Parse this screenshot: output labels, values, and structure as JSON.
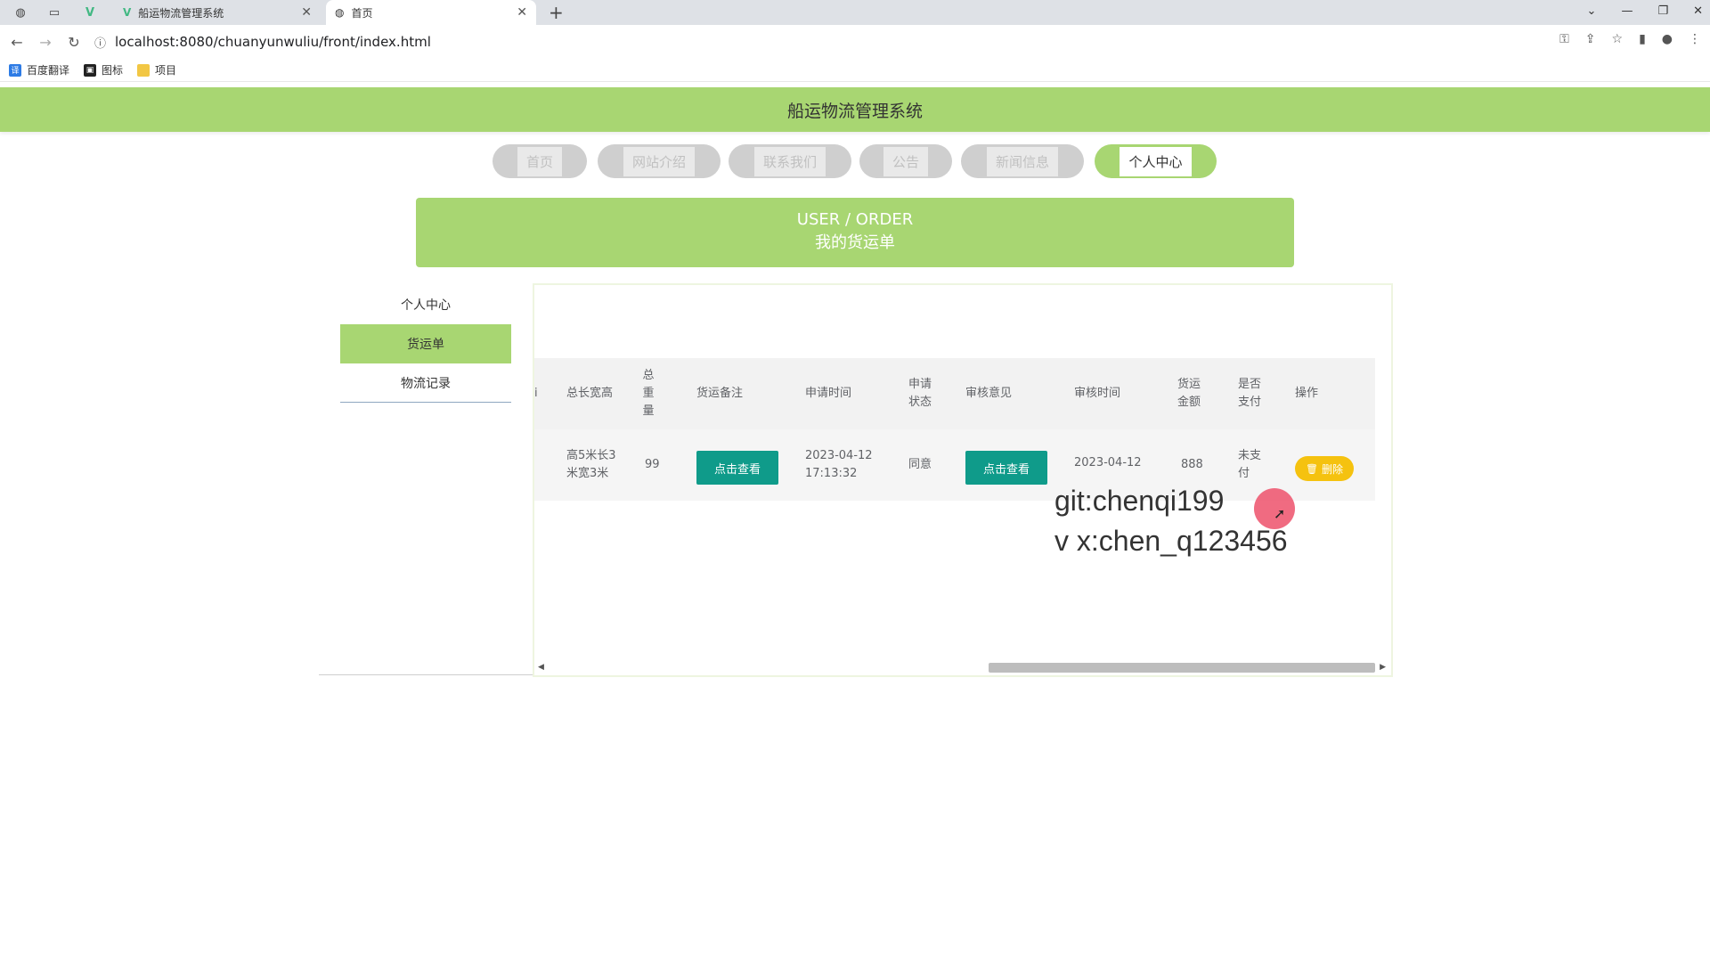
{
  "browser": {
    "tabs": [
      {
        "title": "船运物流管理系统",
        "icon": "vue-logo-icon"
      },
      {
        "title": "首页",
        "icon": "globe-icon"
      }
    ],
    "url": "localhost:8080/chuanyunwuliu/front/index.html",
    "bookmarks": [
      {
        "label": "百度翻译",
        "icon": "translate-icon"
      },
      {
        "label": "图标",
        "icon": "image-icon"
      },
      {
        "label": "项目",
        "icon": "folder-icon"
      }
    ]
  },
  "site": {
    "title": "船运物流管理系统",
    "nav": [
      "首页",
      "网站介绍",
      "联系我们",
      "公告",
      "新闻信息",
      "个人中心"
    ],
    "nav_active": "个人中心"
  },
  "banner": {
    "line1": "USER / ORDER",
    "line2": "我的货运单"
  },
  "sidebar": {
    "items": [
      "个人中心",
      "货运单",
      "物流记录"
    ],
    "active": "货运单"
  },
  "table": {
    "headers": [
      "总长宽高",
      "总重量",
      "货运备注",
      "申请时间",
      "申请状态",
      "审核意见",
      "审核时间",
      "货运金额",
      "是否支付",
      "操作"
    ],
    "rows": [
      {
        "size": "高5米长3米宽3米",
        "weight": "99",
        "remark_button": "点击查看",
        "apply_time": "2023-04-12 17:13:32",
        "apply_status": "同意",
        "review_button": "点击查看",
        "review_time": "2023-04-12",
        "amount": "888",
        "paid": "未支付",
        "delete_button": "删除"
      }
    ]
  },
  "overlay": {
    "line1": "git:chenqi199",
    "line2": "v x:chen_q123456"
  },
  "colors": {
    "accent_green": "#a8d672",
    "teal_button": "#0f9b8a",
    "delete_button": "#f5c20f"
  }
}
